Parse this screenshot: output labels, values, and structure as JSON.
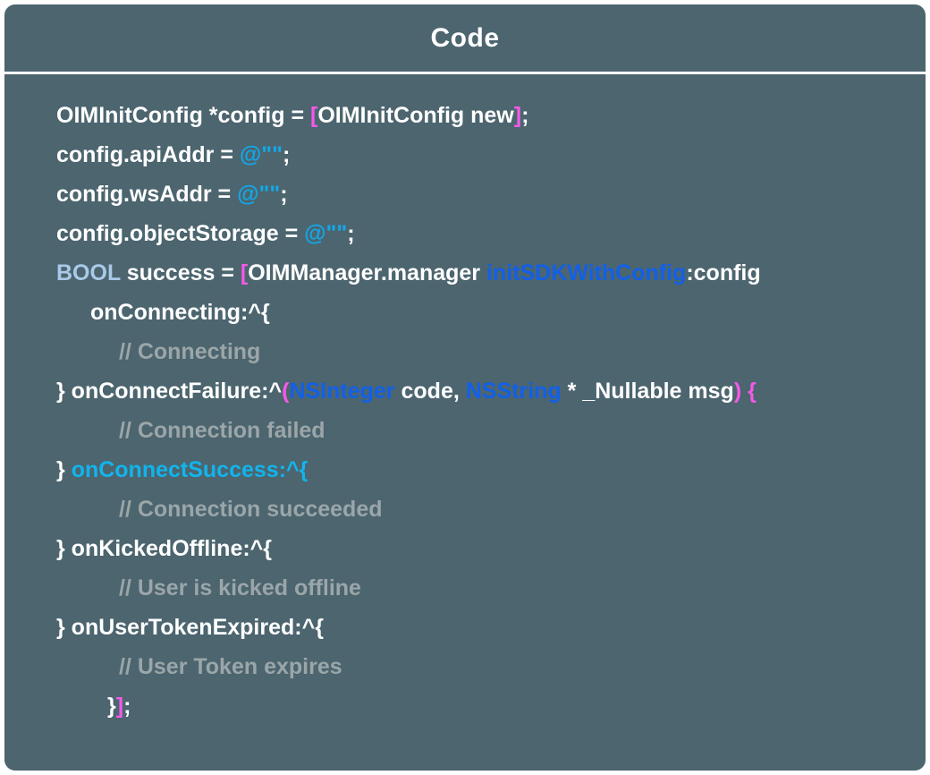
{
  "panel": {
    "title": "Code",
    "language": "objective-c",
    "colors": {
      "background": "#4c656f",
      "border": "#ffffff",
      "plain": "#ffffff",
      "bracket": "#f35ae8",
      "string": "#12a8e8",
      "type_light": "#a9c9e8",
      "method": "#1260e8",
      "cyan": "#12b4ec",
      "comment": "#9ba6a9"
    }
  },
  "code": {
    "lines": [
      {
        "indent": 0,
        "tokens": [
          {
            "text": "OIMInitConfig *config = ",
            "kind": "plain"
          },
          {
            "text": "[",
            "kind": "bracket"
          },
          {
            "text": "OIMInitConfig new",
            "kind": "plain"
          },
          {
            "text": "]",
            "kind": "bracket"
          },
          {
            "text": ";",
            "kind": "plain"
          }
        ]
      },
      {
        "indent": 0,
        "tokens": [
          {
            "text": "config.apiAddr = ",
            "kind": "plain"
          },
          {
            "text": "@\"\"",
            "kind": "string"
          },
          {
            "text": ";",
            "kind": "plain"
          }
        ]
      },
      {
        "indent": 0,
        "tokens": [
          {
            "text": "config.wsAddr = ",
            "kind": "plain"
          },
          {
            "text": "@\"\"",
            "kind": "string"
          },
          {
            "text": ";",
            "kind": "plain"
          }
        ]
      },
      {
        "indent": 0,
        "tokens": [
          {
            "text": "config.objectStorage = ",
            "kind": "plain"
          },
          {
            "text": "@\"\"",
            "kind": "string"
          },
          {
            "text": ";",
            "kind": "plain"
          }
        ]
      },
      {
        "indent": 0,
        "tokens": [
          {
            "text": "BOOL",
            "kind": "type"
          },
          {
            "text": " success = ",
            "kind": "plain"
          },
          {
            "text": "[",
            "kind": "bracket"
          },
          {
            "text": "OIMManager.manager ",
            "kind": "plain"
          },
          {
            "text": "initSDKWithConfig",
            "kind": "method"
          },
          {
            "text": ":config",
            "kind": "plain"
          }
        ]
      },
      {
        "indent": 1,
        "tokens": [
          {
            "text": "onConnecting:^{",
            "kind": "plain"
          }
        ]
      },
      {
        "indent": 2,
        "tokens": [
          {
            "text": "// Connecting",
            "kind": "comment"
          }
        ]
      },
      {
        "indent": 0,
        "tokens": [
          {
            "text": "} onConnectFailure:^",
            "kind": "plain"
          },
          {
            "text": "(",
            "kind": "bracket"
          },
          {
            "text": "NSInteger",
            "kind": "class"
          },
          {
            "text": " code, ",
            "kind": "plain"
          },
          {
            "text": "NSString",
            "kind": "class"
          },
          {
            "text": " * _Nullable msg",
            "kind": "plain"
          },
          {
            "text": ") {",
            "kind": "bracket"
          }
        ]
      },
      {
        "indent": 2,
        "tokens": [
          {
            "text": "// Connection failed",
            "kind": "comment"
          }
        ]
      },
      {
        "indent": 0,
        "tokens": [
          {
            "text": "} ",
            "kind": "plain"
          },
          {
            "text": "onConnectSuccess:^{",
            "kind": "cyan"
          }
        ]
      },
      {
        "indent": 2,
        "tokens": [
          {
            "text": "// Connection succeeded",
            "kind": "comment"
          }
        ]
      },
      {
        "indent": 0,
        "tokens": [
          {
            "text": "} onKickedOffline:^{",
            "kind": "plain"
          }
        ]
      },
      {
        "indent": 2,
        "tokens": [
          {
            "text": "// User is kicked offline",
            "kind": "comment"
          }
        ]
      },
      {
        "indent": 0,
        "tokens": [
          {
            "text": "} onUserTokenExpired:^{",
            "kind": "plain"
          }
        ]
      },
      {
        "indent": 2,
        "tokens": [
          {
            "text": "// User Token expires",
            "kind": "comment"
          }
        ]
      },
      {
        "indent": 3,
        "tokens": [
          {
            "text": "}",
            "kind": "plain"
          },
          {
            "text": "]",
            "kind": "bracket"
          },
          {
            "text": ";",
            "kind": "plain"
          }
        ]
      }
    ]
  }
}
